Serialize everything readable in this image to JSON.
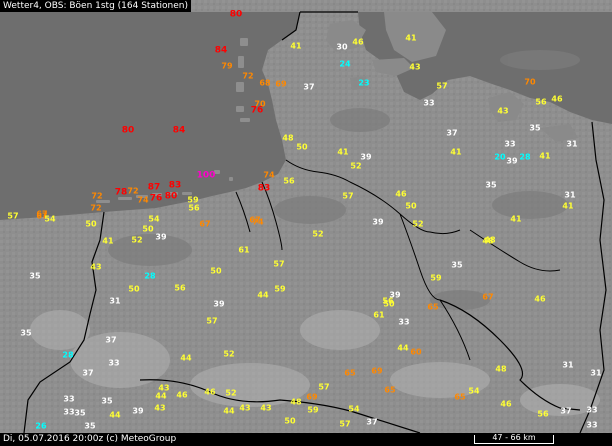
{
  "header": {
    "title": "Wetter4, OBS: Böen 1stg (164 Stationen)"
  },
  "footer": {
    "timestamp": "Di, 05.07.2016 20:00z (c) MeteoGroup",
    "scale": "47 - 66 km"
  },
  "colors": {
    "white": "#ffffff",
    "yellow": "#ffff33",
    "orange": "#ff8800",
    "red": "#ff0000",
    "cyan": "#00ffff",
    "magenta": "#ff00cc",
    "sea": "#6a6a6a",
    "land": "#8e8e8e"
  },
  "stations": [
    {
      "v": "80",
      "c": "red"
    },
    {
      "v": "41",
      "c": "yellow"
    },
    {
      "v": "30",
      "c": "white"
    },
    {
      "v": "46",
      "c": "yellow"
    },
    {
      "v": "41",
      "c": "yellow"
    },
    {
      "v": "84",
      "c": "red"
    },
    {
      "v": "79",
      "c": "orange"
    },
    {
      "v": "24",
      "c": "cyan"
    },
    {
      "v": "72",
      "c": "orange"
    },
    {
      "v": "68",
      "c": "orange"
    },
    {
      "v": "69",
      "c": "orange"
    },
    {
      "v": "37",
      "c": "white"
    },
    {
      "v": "23",
      "c": "cyan"
    },
    {
      "v": "43",
      "c": "yellow"
    },
    {
      "v": "57",
      "c": "yellow"
    },
    {
      "v": "70",
      "c": "orange"
    },
    {
      "v": "70",
      "c": "orange"
    },
    {
      "v": "33",
      "c": "white"
    },
    {
      "v": "56",
      "c": "yellow"
    },
    {
      "v": "46",
      "c": "yellow"
    },
    {
      "v": "76",
      "c": "red"
    },
    {
      "v": "43",
      "c": "yellow"
    },
    {
      "v": "80",
      "c": "red"
    },
    {
      "v": "84",
      "c": "red"
    },
    {
      "v": "37",
      "c": "white"
    },
    {
      "v": "33",
      "c": "white"
    },
    {
      "v": "35",
      "c": "white"
    },
    {
      "v": "48",
      "c": "yellow"
    },
    {
      "v": "50",
      "c": "yellow"
    },
    {
      "v": "41",
      "c": "yellow"
    },
    {
      "v": "39",
      "c": "white"
    },
    {
      "v": "41",
      "c": "yellow"
    },
    {
      "v": "20",
      "c": "cyan"
    },
    {
      "v": "28",
      "c": "cyan"
    },
    {
      "v": "39",
      "c": "white"
    },
    {
      "v": "41",
      "c": "yellow"
    },
    {
      "v": "31",
      "c": "white"
    },
    {
      "v": "52",
      "c": "yellow"
    },
    {
      "v": "100",
      "c": "magenta"
    },
    {
      "v": "74",
      "c": "orange"
    },
    {
      "v": "56",
      "c": "yellow"
    },
    {
      "v": "35",
      "c": "white"
    },
    {
      "v": "83",
      "c": "red"
    },
    {
      "v": "87",
      "c": "red"
    },
    {
      "v": "83",
      "c": "red"
    },
    {
      "v": "72",
      "c": "orange"
    },
    {
      "v": "78",
      "c": "red"
    },
    {
      "v": "72",
      "c": "orange"
    },
    {
      "v": "74",
      "c": "orange"
    },
    {
      "v": "76",
      "c": "red"
    },
    {
      "v": "80",
      "c": "red"
    },
    {
      "v": "59",
      "c": "yellow"
    },
    {
      "v": "57",
      "c": "yellow"
    },
    {
      "v": "46",
      "c": "yellow"
    },
    {
      "v": "31",
      "c": "white"
    },
    {
      "v": "67",
      "c": "orange"
    },
    {
      "v": "72",
      "c": "orange"
    },
    {
      "v": "56",
      "c": "yellow"
    },
    {
      "v": "50",
      "c": "yellow"
    },
    {
      "v": "41",
      "c": "yellow"
    },
    {
      "v": "57",
      "c": "yellow"
    },
    {
      "v": "67",
      "c": "orange"
    },
    {
      "v": "54",
      "c": "yellow"
    },
    {
      "v": "67",
      "c": "orange"
    },
    {
      "v": "54",
      "c": "yellow"
    },
    {
      "v": "67",
      "c": "orange"
    },
    {
      "v": "74",
      "c": "orange"
    },
    {
      "v": "48",
      "c": "yellow"
    },
    {
      "v": "52",
      "c": "yellow"
    },
    {
      "v": "41",
      "c": "yellow"
    },
    {
      "v": "50",
      "c": "yellow"
    },
    {
      "v": "50",
      "c": "yellow"
    },
    {
      "v": "39",
      "c": "white"
    },
    {
      "v": "39",
      "c": "white"
    },
    {
      "v": "52",
      "c": "yellow"
    },
    {
      "v": "61",
      "c": "yellow"
    },
    {
      "v": "52",
      "c": "yellow"
    },
    {
      "v": "48",
      "c": "yellow"
    },
    {
      "v": "41",
      "c": "yellow"
    },
    {
      "v": "43",
      "c": "yellow"
    },
    {
      "v": "57",
      "c": "yellow"
    },
    {
      "v": "35",
      "c": "white"
    },
    {
      "v": "28",
      "c": "cyan"
    },
    {
      "v": "50",
      "c": "yellow"
    },
    {
      "v": "59",
      "c": "yellow"
    },
    {
      "v": "35",
      "c": "white"
    },
    {
      "v": "50",
      "c": "yellow"
    },
    {
      "v": "56",
      "c": "yellow"
    },
    {
      "v": "44",
      "c": "yellow"
    },
    {
      "v": "59",
      "c": "yellow"
    },
    {
      "v": "39",
      "c": "white"
    },
    {
      "v": "67",
      "c": "orange"
    },
    {
      "v": "46",
      "c": "yellow"
    },
    {
      "v": "31",
      "c": "white"
    },
    {
      "v": "39",
      "c": "white"
    },
    {
      "v": "56",
      "c": "yellow"
    },
    {
      "v": "50",
      "c": "yellow"
    },
    {
      "v": "65",
      "c": "orange"
    },
    {
      "v": "57",
      "c": "yellow"
    },
    {
      "v": "61",
      "c": "yellow"
    },
    {
      "v": "33",
      "c": "white"
    },
    {
      "v": "35",
      "c": "white"
    },
    {
      "v": "37",
      "c": "white"
    },
    {
      "v": "52",
      "c": "yellow"
    },
    {
      "v": "44",
      "c": "yellow"
    },
    {
      "v": "60",
      "c": "orange"
    },
    {
      "v": "28",
      "c": "cyan"
    },
    {
      "v": "33",
      "c": "white"
    },
    {
      "v": "44",
      "c": "yellow"
    },
    {
      "v": "31",
      "c": "white"
    },
    {
      "v": "37",
      "c": "white"
    },
    {
      "v": "65",
      "c": "orange"
    },
    {
      "v": "69",
      "c": "orange"
    },
    {
      "v": "48",
      "c": "yellow"
    },
    {
      "v": "31",
      "c": "white"
    },
    {
      "v": "33",
      "c": "white"
    },
    {
      "v": "35",
      "c": "white"
    },
    {
      "v": "46",
      "c": "yellow"
    },
    {
      "v": "43",
      "c": "yellow"
    },
    {
      "v": "44",
      "c": "yellow"
    },
    {
      "v": "57",
      "c": "yellow"
    },
    {
      "v": "65",
      "c": "orange"
    },
    {
      "v": "65",
      "c": "orange"
    },
    {
      "v": "54",
      "c": "yellow"
    },
    {
      "v": "46",
      "c": "yellow"
    },
    {
      "v": "33",
      "c": "white"
    },
    {
      "v": "35",
      "c": "white"
    },
    {
      "v": "46",
      "c": "yellow"
    },
    {
      "v": "52",
      "c": "yellow"
    },
    {
      "v": "69",
      "c": "orange"
    },
    {
      "v": "48",
      "c": "yellow"
    },
    {
      "v": "54",
      "c": "yellow"
    },
    {
      "v": "56",
      "c": "yellow"
    },
    {
      "v": "37",
      "c": "white"
    },
    {
      "v": "33",
      "c": "white"
    },
    {
      "v": "26",
      "c": "cyan"
    },
    {
      "v": "35",
      "c": "white"
    },
    {
      "v": "44",
      "c": "yellow"
    },
    {
      "v": "39",
      "c": "white"
    },
    {
      "v": "43",
      "c": "yellow"
    },
    {
      "v": "44",
      "c": "yellow"
    },
    {
      "v": "43",
      "c": "yellow"
    },
    {
      "v": "43",
      "c": "yellow"
    },
    {
      "v": "50",
      "c": "yellow"
    },
    {
      "v": "59",
      "c": "yellow"
    },
    {
      "v": "57",
      "c": "yellow"
    },
    {
      "v": "37",
      "c": "white"
    },
    {
      "v": "33",
      "c": "white"
    }
  ]
}
